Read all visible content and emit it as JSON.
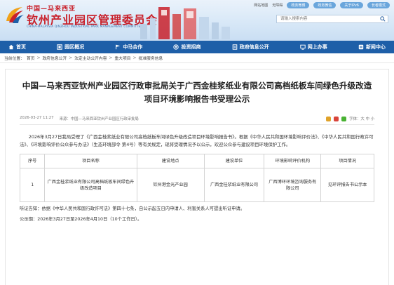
{
  "header": {
    "title_top": "中国—马来西亚",
    "title_main": "钦州产业园区管理委员会",
    "title_en": "CHINA-MALAYSIA QINZHOU INDUSTRIAL PARK MANAGEMENT COMMITTEE",
    "top_links": [
      "网站地图",
      "无障碍",
      "长者模式"
    ],
    "pills": [
      "政务微博",
      "政务微信",
      "关于IPv6",
      "长者模式"
    ],
    "search_placeholder": "请输入搜索内容"
  },
  "nav": {
    "items": [
      {
        "label": "首页",
        "icon": "home-icon"
      },
      {
        "label": "园区概况",
        "icon": "park-icon"
      },
      {
        "label": "中马合作",
        "icon": "flag-icon"
      },
      {
        "label": "投资招商",
        "icon": "invest-icon"
      },
      {
        "label": "政府信息公开",
        "icon": "info-icon"
      },
      {
        "label": "网上办事",
        "icon": "online-icon"
      },
      {
        "label": "新闻中心",
        "icon": "news-icon"
      }
    ]
  },
  "breadcrumb": {
    "prefix": "当前位置：",
    "items": [
      "首页",
      "政府信息公开",
      "法定主动公开内容",
      "重大项目",
      "批准服务信息"
    ]
  },
  "article": {
    "title": "中国—马来西亚钦州产业园区行政审批局关于广西金桂浆纸业有限公司高档纸板车间绿色升级改造项目环境影响报告书受理公示",
    "date": "2026-03-27 11:27",
    "source": "来源：中国—马来西亚钦州产业园区行政审批局",
    "font_size_label": "字体：大 中 小",
    "body": "2026年3月27日我局受理了《广西金桂浆纸业有限公司高档纸板车间绿色升级改造项目环境影响报告书》。根据《中华人民共和国环境影响评价法》、《中华人民共和国行政许可法》、《环境影响评价公众参与办法》（生态环境部令 第4号）等有关规定，现将受理情况予以公示，欢迎公众参与建设项目环境保护工作。",
    "table": {
      "headers": [
        "序号",
        "项目名称",
        "建设地点",
        "建设单位",
        "环境影响评价机构",
        "项目情况"
      ],
      "rows": [
        [
          "1",
          "广西金桂浆纸业有限公司高档纸板车间绿色升级改造项目",
          "钦州港金光产业园",
          "广西金桂浆纸业有限公司",
          "广西博环环境咨询服务有限公司",
          "见环评报告书公示本"
        ]
      ]
    },
    "hearing": "听证告知：依据《中华人民共和国行政许可法》第四十七条，自公示起五日内申请人、利害关系人可提出听证申请。",
    "period": "公示期：2026年3月27日至2026年4月10日（10个工作日）。"
  }
}
